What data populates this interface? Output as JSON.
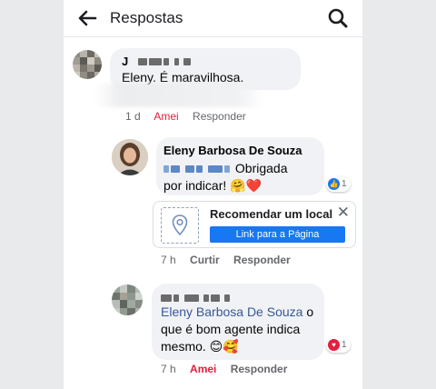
{
  "header": {
    "title": "Respostas"
  },
  "comments": [
    {
      "author_visible": "J",
      "text": "Eleny. É maravilhosa.",
      "time": "1 d",
      "reaction_label": "Amei",
      "reply_label": "Responder"
    },
    {
      "author": "Eleny Barbosa De Souza",
      "text_line1": "Obrigada",
      "text_line2": "por indicar! 🤗❤️",
      "reaction_count": "1",
      "time": "7 h",
      "like_label": "Curtir",
      "reply_label": "Responder"
    },
    {
      "mention": "Eleny Barbosa De Souza",
      "text_after_mention": " o",
      "text_line2": "que é bom agente indica",
      "text_line3": "mesmo. 😊🥰",
      "reaction_count": "1",
      "time": "7 h",
      "reaction_label": "Amei",
      "reply_label": "Responder"
    }
  ],
  "recommend": {
    "title": "Recomendar um local",
    "button": "Link para a Página",
    "close": "✕"
  },
  "colors": {
    "link": "#385898",
    "love": "#e41e3f",
    "button": "#1877f2"
  }
}
